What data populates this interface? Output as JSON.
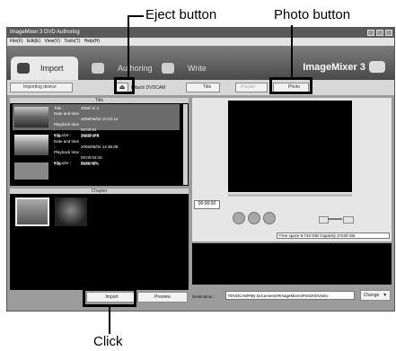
{
  "callouts": {
    "eject": "Eject button",
    "photo": "Photo button",
    "click": "Click"
  },
  "window": {
    "title": "ImageMixer 3 DVD Authoring",
    "menus": [
      "File(F)",
      "Edit(E)",
      "View(V)",
      "Tools(T)",
      "Help(H)"
    ],
    "tabs": [
      "Import",
      "Authoring",
      "Write"
    ],
    "brand": "ImageMixer 3"
  },
  "toolbar": {
    "importing_device": "Importing device",
    "device_name": "Hitachi DVDCAM",
    "title_btn": "Title",
    "playlist_btn": "Playlist",
    "photo_btn": "Photo"
  },
  "title_panel": {
    "header": "Title",
    "labels": {
      "title": "Title :",
      "date": "Date and time :",
      "playback": "Playback time :",
      "size": "File size :"
    },
    "items": [
      {
        "title": "2006/ 5/ 3",
        "date": "2006/05/03 10:22:12",
        "playback": "00:00:01",
        "size": "36235 MB"
      },
      {
        "title": "2006/ 5/ 4",
        "date": "2006/05/04 14:36:39",
        "playback": "00:00:03:15",
        "size": "9176 MB"
      },
      {
        "title": "2006/ 5/ 5",
        "date": "",
        "playback": "",
        "size": ""
      }
    ]
  },
  "chapter_panel": {
    "header": "Chapter"
  },
  "buttons": {
    "import": "Import",
    "preview": "Preview",
    "change": "Change"
  },
  "player": {
    "timecode": "00:00:00"
  },
  "disk_space": "Free space 6.710 GB/ Capacity 37229 GB",
  "destination": {
    "label": "Destination :",
    "path": "#DVDCAM#My Documents#ImageMixer3#ImDVDVideo"
  }
}
